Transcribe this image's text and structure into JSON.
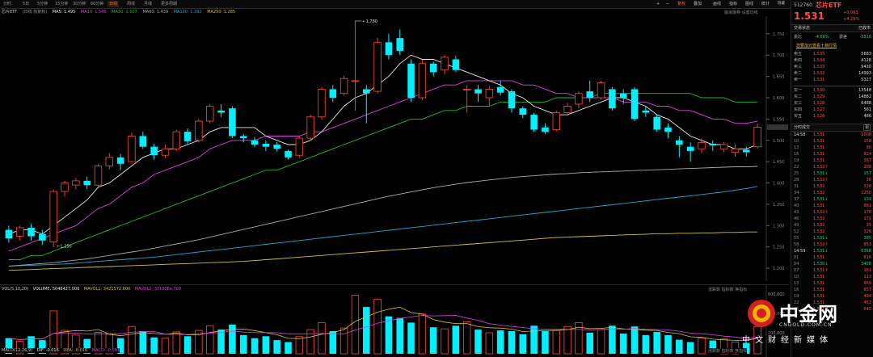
{
  "toolbar": {
    "tabs": [
      "分时",
      "5日",
      "5分钟",
      "15分钟",
      "30分钟",
      "60分钟",
      "日线",
      "周线",
      "月线",
      "更多周期"
    ],
    "active_tab": "日线",
    "tools": [
      "复权",
      "叠加",
      "画线",
      "指标",
      "图线",
      "统计",
      "周可",
      "隐藏"
    ],
    "icons": [
      "+",
      "−",
      "▭",
      "⛶",
      "✕"
    ]
  },
  "legend": {
    "name": "芯片ETF",
    "mode": "(日线 前复权)",
    "ma5": "MA5: 1.495",
    "ma10": "MA10: 1.545",
    "ma30": "MA30: 1.507",
    "ma60": "MA60: 1.439",
    "ma120": "MA120: 1.392",
    "ma250": "MA250: 1.285",
    "right": "融资融券  设置均线"
  },
  "colors": {
    "up": "#e8442e",
    "down": "#00f0ff",
    "ma5": "#e8e8e8",
    "ma10": "#e040e0",
    "ma30": "#22bb22",
    "ma60": "#aaaaaa",
    "ma120": "#22aacc",
    "ma250": "#d2c23c"
  },
  "chart_data": {
    "type": "candlestick",
    "price_ticks": [
      "1.750",
      "1.700",
      "1.650",
      "1.600",
      "1.550",
      "1.500",
      "1.450",
      "1.400",
      "1.350",
      "1.300",
      "1.250",
      "1.200"
    ],
    "price_range": [
      1.185,
      1.78
    ],
    "high_mark": "1.780",
    "low_mark": "1.250",
    "candles": [
      {
        "o": 1.29,
        "c": 1.27,
        "h": 1.3,
        "l": 1.26
      },
      {
        "o": 1.275,
        "c": 1.295,
        "h": 1.3,
        "l": 1.265
      },
      {
        "o": 1.295,
        "c": 1.275,
        "h": 1.305,
        "l": 1.265
      },
      {
        "o": 1.28,
        "c": 1.265,
        "h": 1.29,
        "l": 1.255
      },
      {
        "o": 1.262,
        "c": 1.38,
        "h": 1.385,
        "l": 1.25
      },
      {
        "o": 1.38,
        "c": 1.4,
        "h": 1.405,
        "l": 1.368
      },
      {
        "o": 1.395,
        "c": 1.405,
        "h": 1.412,
        "l": 1.385
      },
      {
        "o": 1.405,
        "c": 1.395,
        "h": 1.415,
        "l": 1.385
      },
      {
        "o": 1.395,
        "c": 1.44,
        "h": 1.445,
        "l": 1.39
      },
      {
        "o": 1.44,
        "c": 1.46,
        "h": 1.47,
        "l": 1.432
      },
      {
        "o": 1.46,
        "c": 1.445,
        "h": 1.468,
        "l": 1.43
      },
      {
        "o": 1.45,
        "c": 1.51,
        "h": 1.518,
        "l": 1.448
      },
      {
        "o": 1.51,
        "c": 1.485,
        "h": 1.52,
        "l": 1.48
      },
      {
        "o": 1.485,
        "c": 1.465,
        "h": 1.492,
        "l": 1.455
      },
      {
        "o": 1.465,
        "c": 1.48,
        "h": 1.49,
        "l": 1.458
      },
      {
        "o": 1.48,
        "c": 1.52,
        "h": 1.525,
        "l": 1.475
      },
      {
        "o": 1.52,
        "c": 1.498,
        "h": 1.528,
        "l": 1.49
      },
      {
        "o": 1.5,
        "c": 1.545,
        "h": 1.55,
        "l": 1.495
      },
      {
        "o": 1.545,
        "c": 1.58,
        "h": 1.585,
        "l": 1.54
      },
      {
        "o": 1.57,
        "c": 1.565,
        "h": 1.585,
        "l": 1.555
      },
      {
        "o": 1.575,
        "c": 1.51,
        "h": 1.58,
        "l": 1.505
      },
      {
        "o": 1.51,
        "c": 1.505,
        "h": 1.515,
        "l": 1.495
      },
      {
        "o": 1.5,
        "c": 1.49,
        "h": 1.508,
        "l": 1.484
      },
      {
        "o": 1.492,
        "c": 1.485,
        "h": 1.5,
        "l": 1.475
      },
      {
        "o": 1.49,
        "c": 1.48,
        "h": 1.496,
        "l": 1.474
      },
      {
        "o": 1.475,
        "c": 1.46,
        "h": 1.478,
        "l": 1.455
      },
      {
        "o": 1.465,
        "c": 1.505,
        "h": 1.51,
        "l": 1.46
      },
      {
        "o": 1.505,
        "c": 1.555,
        "h": 1.56,
        "l": 1.5
      },
      {
        "o": 1.555,
        "c": 1.62,
        "h": 1.625,
        "l": 1.548
      },
      {
        "o": 1.62,
        "c": 1.6,
        "h": 1.63,
        "l": 1.59
      },
      {
        "o": 1.61,
        "c": 1.645,
        "h": 1.652,
        "l": 1.605
      },
      {
        "o": 1.64,
        "c": 1.64,
        "h": 1.78,
        "l": 1.57
      },
      {
        "o": 1.62,
        "c": 1.61,
        "h": 1.63,
        "l": 1.54
      },
      {
        "o": 1.615,
        "c": 1.73,
        "h": 1.74,
        "l": 1.61
      },
      {
        "o": 1.73,
        "c": 1.7,
        "h": 1.75,
        "l": 1.69
      },
      {
        "o": 1.74,
        "c": 1.71,
        "h": 1.76,
        "l": 1.7
      },
      {
        "o": 1.68,
        "c": 1.6,
        "h": 1.69,
        "l": 1.59
      },
      {
        "o": 1.6,
        "c": 1.68,
        "h": 1.69,
        "l": 1.595
      },
      {
        "o": 1.68,
        "c": 1.66,
        "h": 1.685,
        "l": 1.65
      },
      {
        "o": 1.665,
        "c": 1.695,
        "h": 1.7,
        "l": 1.655
      },
      {
        "o": 1.69,
        "c": 1.665,
        "h": 1.698,
        "l": 1.66
      },
      {
        "o": 1.62,
        "c": 1.62,
        "h": 1.63,
        "l": 1.565
      },
      {
        "o": 1.62,
        "c": 1.61,
        "h": 1.63,
        "l": 1.59
      },
      {
        "o": 1.6,
        "c": 1.62,
        "h": 1.628,
        "l": 1.58
      },
      {
        "o": 1.625,
        "c": 1.612,
        "h": 1.64,
        "l": 1.605
      },
      {
        "o": 1.615,
        "c": 1.575,
        "h": 1.62,
        "l": 1.565
      },
      {
        "o": 1.575,
        "c": 1.56,
        "h": 1.58,
        "l": 1.552
      },
      {
        "o": 1.56,
        "c": 1.525,
        "h": 1.565,
        "l": 1.52
      },
      {
        "o": 1.53,
        "c": 1.52,
        "h": 1.54,
        "l": 1.515
      },
      {
        "o": 1.525,
        "c": 1.565,
        "h": 1.57,
        "l": 1.52
      },
      {
        "o": 1.565,
        "c": 1.58,
        "h": 1.588,
        "l": 1.558
      },
      {
        "o": 1.585,
        "c": 1.61,
        "h": 1.615,
        "l": 1.575
      },
      {
        "o": 1.615,
        "c": 1.6,
        "h": 1.64,
        "l": 1.59
      },
      {
        "o": 1.6,
        "c": 1.635,
        "h": 1.64,
        "l": 1.595
      },
      {
        "o": 1.62,
        "c": 1.575,
        "h": 1.625,
        "l": 1.57
      },
      {
        "o": 1.61,
        "c": 1.6,
        "h": 1.62,
        "l": 1.585
      },
      {
        "o": 1.62,
        "c": 1.55,
        "h": 1.625,
        "l": 1.545
      },
      {
        "o": 1.57,
        "c": 1.565,
        "h": 1.58,
        "l": 1.555
      },
      {
        "o": 1.555,
        "c": 1.525,
        "h": 1.56,
        "l": 1.52
      },
      {
        "o": 1.53,
        "c": 1.52,
        "h": 1.54,
        "l": 1.505
      },
      {
        "o": 1.5,
        "c": 1.49,
        "h": 1.51,
        "l": 1.46
      },
      {
        "o": 1.485,
        "c": 1.475,
        "h": 1.495,
        "l": 1.45
      },
      {
        "o": 1.48,
        "c": 1.495,
        "h": 1.505,
        "l": 1.47
      },
      {
        "o": 1.492,
        "c": 1.488,
        "h": 1.5,
        "l": 1.475
      },
      {
        "o": 1.48,
        "c": 1.49,
        "h": 1.496,
        "l": 1.472
      },
      {
        "o": 1.472,
        "c": 1.48,
        "h": 1.49,
        "l": 1.462
      },
      {
        "o": 1.478,
        "c": 1.472,
        "h": 1.485,
        "l": 1.462
      },
      {
        "o": 1.485,
        "c": 1.531,
        "h": 1.54,
        "l": 1.48
      }
    ],
    "volume": [
      40,
      32,
      45,
      35,
      110,
      60,
      48,
      38,
      55,
      50,
      40,
      70,
      58,
      42,
      40,
      56,
      45,
      60,
      72,
      62,
      75,
      48,
      40,
      45,
      35,
      30,
      44,
      62,
      80,
      58,
      66,
      150,
      120,
      140,
      96,
      92,
      80,
      102,
      68,
      64,
      72,
      82,
      62,
      54,
      60,
      58,
      50,
      72,
      58,
      60,
      70,
      80,
      54,
      62,
      72,
      52,
      70,
      48,
      56,
      48,
      36,
      30,
      40,
      34,
      38,
      30,
      28,
      70
    ],
    "vol_ticks": [
      "600,000",
      "400,000",
      "200,000"
    ],
    "ma_values": {
      "ma5": [
        1.28,
        1.29,
        1.29,
        1.28,
        1.3,
        1.32,
        1.34,
        1.36,
        1.39,
        1.4,
        1.42,
        1.44,
        1.46,
        1.47,
        1.48,
        1.48,
        1.49,
        1.5,
        1.52,
        1.53,
        1.53,
        1.53,
        1.53,
        1.51,
        1.5,
        1.49,
        1.49,
        1.5,
        1.52,
        1.55,
        1.58,
        1.6,
        1.61,
        1.63,
        1.65,
        1.68,
        1.7,
        1.69,
        1.69,
        1.68,
        1.67,
        1.66,
        1.65,
        1.64,
        1.63,
        1.61,
        1.6,
        1.58,
        1.57,
        1.56,
        1.56,
        1.57,
        1.58,
        1.59,
        1.6,
        1.6,
        1.59,
        1.58,
        1.56,
        1.55,
        1.53,
        1.51,
        1.5,
        1.49,
        1.49,
        1.48,
        1.48,
        1.49
      ],
      "ma10": [
        1.24,
        1.25,
        1.26,
        1.27,
        1.28,
        1.29,
        1.3,
        1.32,
        1.34,
        1.35,
        1.37,
        1.39,
        1.4,
        1.42,
        1.43,
        1.44,
        1.45,
        1.46,
        1.48,
        1.49,
        1.5,
        1.5,
        1.5,
        1.51,
        1.51,
        1.51,
        1.51,
        1.52,
        1.52,
        1.53,
        1.54,
        1.55,
        1.56,
        1.57,
        1.58,
        1.59,
        1.6,
        1.61,
        1.62,
        1.63,
        1.63,
        1.64,
        1.64,
        1.64,
        1.64,
        1.64,
        1.63,
        1.63,
        1.62,
        1.61,
        1.61,
        1.6,
        1.6,
        1.6,
        1.6,
        1.59,
        1.59,
        1.59,
        1.58,
        1.58,
        1.57,
        1.57,
        1.56,
        1.55,
        1.55,
        1.54,
        1.54,
        1.545
      ],
      "ma30": [
        1.22,
        1.22,
        1.23,
        1.23,
        1.24,
        1.25,
        1.26,
        1.27,
        1.28,
        1.29,
        1.3,
        1.31,
        1.32,
        1.33,
        1.34,
        1.35,
        1.36,
        1.37,
        1.38,
        1.39,
        1.4,
        1.41,
        1.42,
        1.43,
        1.43,
        1.44,
        1.45,
        1.46,
        1.47,
        1.48,
        1.49,
        1.5,
        1.51,
        1.52,
        1.53,
        1.54,
        1.55,
        1.55,
        1.56,
        1.57,
        1.57,
        1.58,
        1.58,
        1.58,
        1.59,
        1.59,
        1.59,
        1.59,
        1.59,
        1.6,
        1.6,
        1.6,
        1.6,
        1.61,
        1.61,
        1.61,
        1.61,
        1.61,
        1.61,
        1.61,
        1.61,
        1.61,
        1.6,
        1.6,
        1.6,
        1.59,
        1.59,
        1.59
      ],
      "ma60": [
        1.205,
        1.207,
        1.209,
        1.211,
        1.213,
        1.216,
        1.219,
        1.222,
        1.226,
        1.23,
        1.234,
        1.238,
        1.242,
        1.247,
        1.252,
        1.257,
        1.262,
        1.267,
        1.273,
        1.279,
        1.285,
        1.291,
        1.297,
        1.303,
        1.309,
        1.315,
        1.321,
        1.327,
        1.333,
        1.339,
        1.345,
        1.351,
        1.357,
        1.363,
        1.369,
        1.374,
        1.379,
        1.384,
        1.389,
        1.393,
        1.397,
        1.401,
        1.404,
        1.407,
        1.41,
        1.413,
        1.415,
        1.417,
        1.419,
        1.421,
        1.422,
        1.424,
        1.425,
        1.426,
        1.427,
        1.428,
        1.429,
        1.43,
        1.431,
        1.432,
        1.433,
        1.434,
        1.435,
        1.436,
        1.437,
        1.438,
        1.438,
        1.439
      ],
      "ma120": [
        1.205,
        1.206,
        1.207,
        1.208,
        1.209,
        1.21,
        1.212,
        1.214,
        1.216,
        1.218,
        1.22,
        1.222,
        1.224,
        1.226,
        1.229,
        1.232,
        1.235,
        1.238,
        1.241,
        1.244,
        1.247,
        1.25,
        1.253,
        1.256,
        1.259,
        1.262,
        1.265,
        1.268,
        1.271,
        1.274,
        1.277,
        1.28,
        1.283,
        1.286,
        1.289,
        1.292,
        1.295,
        1.298,
        1.301,
        1.304,
        1.307,
        1.31,
        1.313,
        1.316,
        1.319,
        1.322,
        1.325,
        1.328,
        1.331,
        1.334,
        1.337,
        1.34,
        1.343,
        1.346,
        1.349,
        1.352,
        1.355,
        1.358,
        1.361,
        1.364,
        1.367,
        1.37,
        1.373,
        1.376,
        1.379,
        1.383,
        1.387,
        1.392
      ],
      "ma250": [
        1.195,
        1.196,
        1.197,
        1.198,
        1.199,
        1.2,
        1.201,
        1.202,
        1.203,
        1.204,
        1.205,
        1.206,
        1.207,
        1.208,
        1.209,
        1.21,
        1.211,
        1.212,
        1.213,
        1.214,
        1.215,
        1.216,
        1.218,
        1.22,
        1.222,
        1.224,
        1.226,
        1.228,
        1.23,
        1.232,
        1.234,
        1.236,
        1.238,
        1.24,
        1.242,
        1.244,
        1.246,
        1.248,
        1.25,
        1.252,
        1.254,
        1.256,
        1.258,
        1.26,
        1.262,
        1.264,
        1.266,
        1.268,
        1.27,
        1.272,
        1.273,
        1.274,
        1.275,
        1.276,
        1.277,
        1.278,
        1.279,
        1.28,
        1.281,
        1.281,
        1.282,
        1.282,
        1.283,
        1.283,
        1.284,
        1.284,
        1.285,
        1.285
      ]
    }
  },
  "vol_legend": {
    "a": "VOL(5,10,20)",
    "b": "VOLUME: 5046427.000",
    "c": "MAVOL1: 3421572.600",
    "d": "MAVOL2: 371006e.700"
  },
  "vol_right": "涨跌数  指标数  换指标",
  "macd_legend": {
    "a": "MACD(12,26,9)",
    "b": "DIF: -0.016",
    "c": "DEA: -0.016",
    "d": "MACD: -0.001"
  },
  "macd_right": "涨跌数  指标数  换指标",
  "sidebar": {
    "code": "512760",
    "name": "芯片ETF",
    "price": "1.531",
    "change": "+0.063",
    "pct": "+4.29%",
    "status_label": "交易状态",
    "status_value": "已收市",
    "weibi_label": "委比",
    "weibi_value": "-4.66%",
    "weicha_label": "委差",
    "weicha_value": "-3516",
    "hint": "您要加元查看十档行情",
    "asks": [
      {
        "lbl": "卖五",
        "p": "1.535",
        "v": "5683"
      },
      {
        "lbl": "卖四",
        "p": "1.534",
        "v": "4128"
      },
      {
        "lbl": "卖三",
        "p": "1.533",
        "v": "9430"
      },
      {
        "lbl": "卖二",
        "p": "1.532",
        "v": "14993"
      },
      {
        "lbl": "卖一",
        "p": "1.531",
        "v": "5327"
      }
    ],
    "bids": [
      {
        "lbl": "买一",
        "p": "1.530",
        "v": "13548"
      },
      {
        "lbl": "买二",
        "p": "1.529",
        "v": "14882"
      },
      {
        "lbl": "买三",
        "p": "1.528",
        "v": "6488"
      },
      {
        "lbl": "买四",
        "p": "1.527",
        "v": "561"
      },
      {
        "lbl": "买五",
        "p": "1.526",
        "v": "486"
      }
    ],
    "tick_title": "分时成交",
    "tick_btn": "更",
    "ticks": [
      {
        "t": "14:58",
        "p": "1.531",
        "v": "1008"
      },
      {
        "t": "10",
        "p": "1.531",
        "v": "158"
      },
      {
        "t": "13",
        "p": "1.531",
        "v": "90"
      },
      {
        "t": "16",
        "p": "1.531",
        "v": "824"
      },
      {
        "t": "19",
        "p": "1.531",
        "v": "367"
      },
      {
        "t": "22",
        "p": "1.532↑",
        "v": "208"
      },
      {
        "t": "25",
        "p": "1.531↓",
        "v": "157"
      },
      {
        "t": "28",
        "p": "1.532↑",
        "v": "36"
      },
      {
        "t": "31",
        "p": "1.532",
        "v": "338"
      },
      {
        "t": "34",
        "p": "1.532",
        "v": "1250"
      },
      {
        "t": "37",
        "p": "1.531↓",
        "v": "134"
      },
      {
        "t": "40",
        "p": "1.531",
        "v": "661"
      },
      {
        "t": "43",
        "p": "1.532↑",
        "v": "176"
      },
      {
        "t": "46",
        "p": "1.532",
        "v": "171"
      },
      {
        "t": "49",
        "p": "1.532",
        "v": "35"
      },
      {
        "t": "52",
        "p": "1.532",
        "v": "326"
      },
      {
        "t": "55",
        "p": "1.531↓",
        "v": "385"
      },
      {
        "t": "58",
        "p": "1.532↑",
        "v": "853"
      },
      {
        "t": "14:59",
        "p": "1.531↓",
        "v": "6368"
      },
      {
        "t": "01",
        "p": "1.531",
        "v": "616"
      },
      {
        "t": "04",
        "p": "1.530↓",
        "v": "3408"
      },
      {
        "t": "07",
        "p": "1.531↑",
        "v": "161"
      },
      {
        "t": "10",
        "p": "1.531",
        "v": "113"
      },
      {
        "t": "13",
        "p": "1.531",
        "v": "869"
      },
      {
        "t": "16",
        "p": "1.531",
        "v": "657"
      },
      {
        "t": "19",
        "p": "1.531",
        "v": "494"
      },
      {
        "t": "22",
        "p": "1.531",
        "v": "452"
      },
      {
        "t": "25",
        "p": "1.531",
        "v": "645"
      }
    ]
  },
  "watermark": {
    "brand": "中金网",
    "domain": "CNGOLD.COM.CN",
    "tagline": "中文财经新媒体"
  }
}
